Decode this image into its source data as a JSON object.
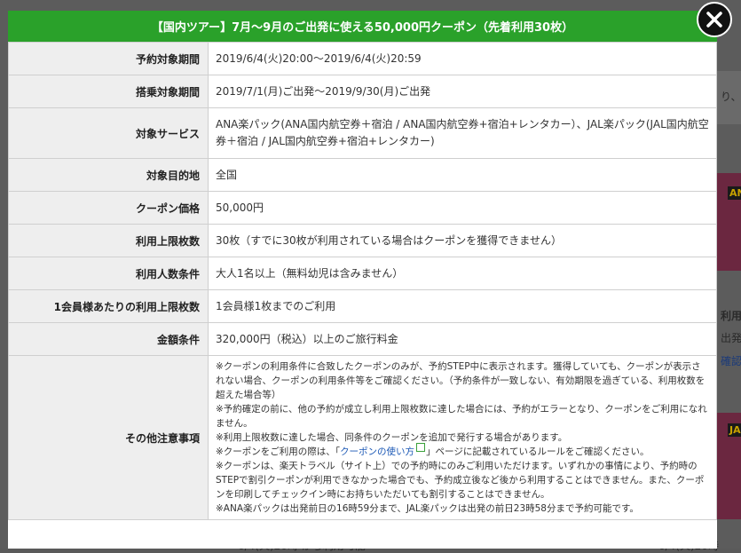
{
  "modal": {
    "title": "【国内ツアー】7月～9月のご出発に使える50,000円クーポン（先着利用30枚）",
    "rows": [
      {
        "label": "予約対象期間",
        "value": "2019/6/4(火)20:00～2019/6/4(火)20:59"
      },
      {
        "label": "搭乗対象期間",
        "value": "2019/7/1(月)ご出発～2019/9/30(月)ご出発"
      },
      {
        "label": "対象サービス",
        "value": "ANA楽パック(ANA国内航空券＋宿泊 / ANA国内航空券+宿泊+レンタカー）、JAL楽パック(JAL国内航空券＋宿泊 / JAL国内航空券+宿泊+レンタカー)"
      },
      {
        "label": "対象目的地",
        "value": "全国"
      },
      {
        "label": "クーポン価格",
        "value": "50,000円"
      },
      {
        "label": "利用上限枚数",
        "value": "30枚（すでに30枚が利用されている場合はクーポンを獲得できません）"
      },
      {
        "label": "利用人数条件",
        "value": "大人1名以上（無料幼児は含みません）"
      },
      {
        "label": "1会員様あたりの利用上限枚数",
        "value": "1会員様1枚までのご利用"
      },
      {
        "label": "金額条件",
        "value": "320,000円（税込）以上のご旅行料金"
      }
    ],
    "notes": {
      "label": "その他注意事項",
      "p1": "※クーポンの利用条件に合致したクーポンのみが、予約STEP中に表示されます。獲得していても、クーポンが表示されない場合、クーポンの利用条件等をご確認ください。（予約条件が一致しない、有効期限を過ぎている、利用枚数を超えた場合等）",
      "p2": "※予約確定の前に、他の予約が成立し利用上限枚数に達した場合には、予約がエラーとなり、クーポンをご利用になれません。",
      "p3": "※利用上限枚数に達した場合、同条件のクーポンを追加で発行する場合があります。",
      "p4_before": "※クーポンをご利用の際は、「",
      "p4_link": "クーポンの使い方",
      "p4_after": "」ページに記載されているルールをご確認ください。",
      "p5": "※クーポンは、楽天トラベル（サイト上）での予約時にのみご利用いただけます。いずれかの事情により、予約時のSTEPで割引クーポンが利用できなかった場合でも、予約成立後など後から利用することはできません。また、クーポンを印刷してチェックイン時にお持ちいただいても割引することはできません。",
      "p6": "※ANA楽パックは出発前日の16時59分まで、JAL楽パックは出発の前日23時58分まで予約可能です。"
    }
  },
  "background": {
    "snippet_ri": "り、",
    "snippet_ri_yo": "利用",
    "snippet_hatsu": "出発",
    "snippet_kakunin": "確認",
    "badge_ana": "AN",
    "badge_jal": "JA",
    "bottom_left": "6/4(火)20時 から利用可能",
    "bottom_right": "6/4(火)20時"
  },
  "colors": {
    "header": "#2aa12a",
    "link": "#1a57b5",
    "label_bg": "#eeeeee"
  }
}
